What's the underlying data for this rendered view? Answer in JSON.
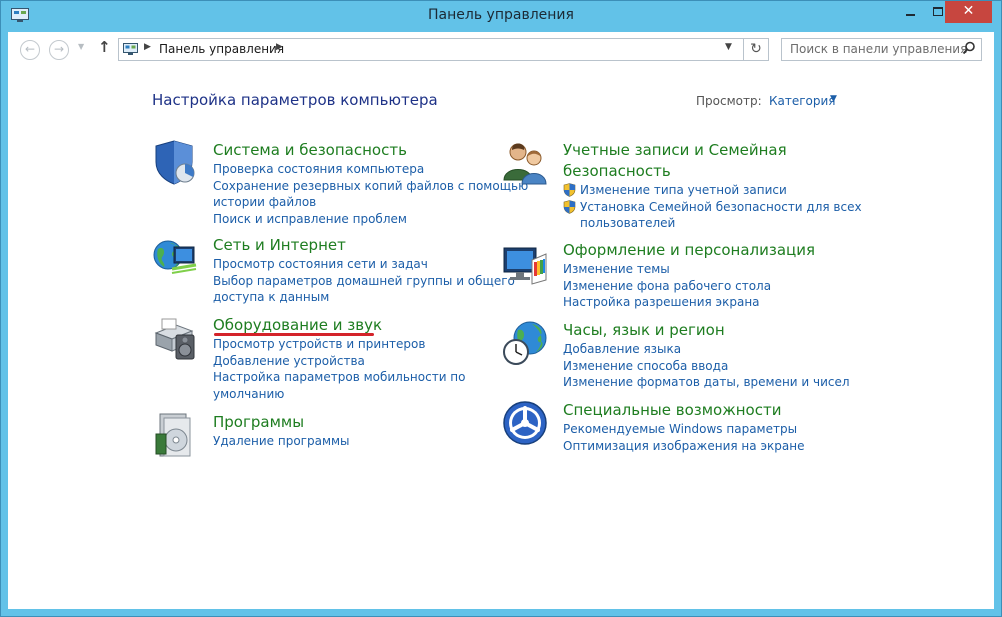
{
  "window": {
    "title": "Панель управления",
    "close_label": "✕"
  },
  "address": {
    "path": "Панель управления",
    "search_placeholder": "Поиск в панели управления"
  },
  "heading": "Настройка параметров компьютера",
  "view": {
    "label": "Просмотр:",
    "value": "Категория"
  },
  "categories": [
    {
      "title": "Система и безопасность",
      "links": [
        "Проверка состояния компьютера",
        "Сохранение резервных копий файлов с помощью",
        "истории файлов",
        "Поиск и исправление проблем"
      ]
    },
    {
      "title": "Сеть и Интернет",
      "links": [
        "Просмотр состояния сети и задач",
        "Выбор параметров домашней группы и общего",
        "доступа к данным"
      ]
    },
    {
      "title": "Оборудование и звук",
      "links": [
        "Просмотр устройств и принтеров",
        "Добавление устройства",
        "Настройка параметров мобильности по",
        "умолчанию"
      ]
    },
    {
      "title": "Программы",
      "links": [
        "Удаление программы"
      ]
    },
    {
      "title_line1": "Учетные записи и Семейная",
      "title_line2": "безопасность",
      "links": [
        "Изменение типа учетной записи",
        "Установка Семейной безопасности для всех",
        "пользователей"
      ]
    },
    {
      "title": "Оформление и персонализация",
      "links": [
        "Изменение темы",
        "Изменение фона рабочего стола",
        "Настройка разрешения экрана"
      ]
    },
    {
      "title": "Часы, язык и регион",
      "links": [
        "Добавление языка",
        "Изменение способа ввода",
        "Изменение форматов даты, времени и чисел"
      ]
    },
    {
      "title": "Специальные возможности",
      "links": [
        "Рекомендуемые Windows параметры",
        "Оптимизация изображения на экране"
      ]
    }
  ],
  "colors": {
    "window_frame": "#62c2e8",
    "close_button": "#c7463f",
    "category_title": "#1e7d20",
    "link": "#1c5ea8",
    "annotation_underline": "#d4232a"
  }
}
